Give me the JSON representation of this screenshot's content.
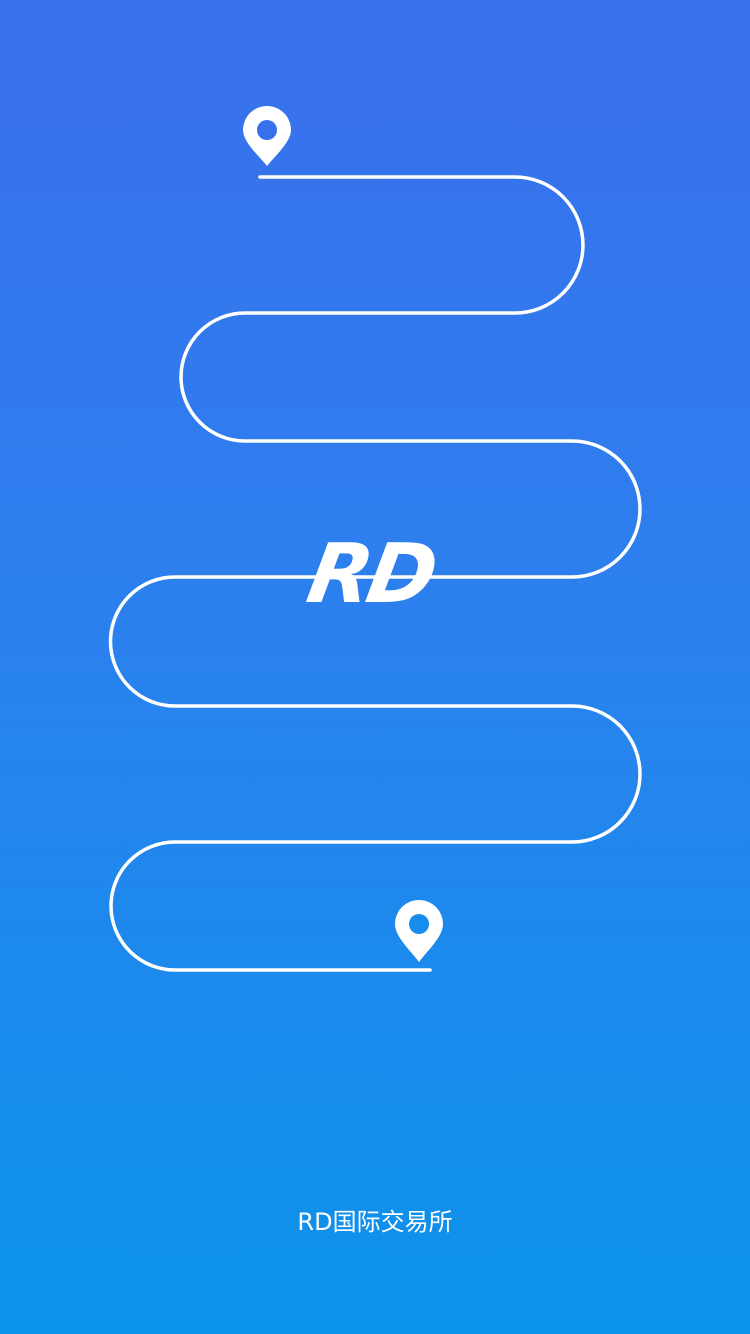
{
  "splash": {
    "logo_text": "RD",
    "footer_text": "RD国际交易所"
  },
  "icons": {
    "start": "map-pin-icon",
    "end": "map-pin-icon"
  },
  "colors": {
    "gradient_top": "#3a6fec",
    "gradient_bottom": "#0b93ea",
    "line": "#ffffff"
  }
}
